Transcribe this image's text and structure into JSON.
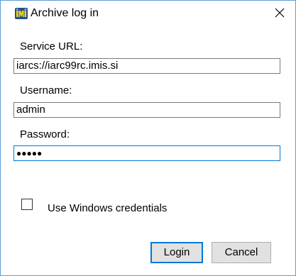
{
  "window": {
    "title": "Archive log in",
    "app_icon": "imis-logo-icon",
    "close_glyph": "close-icon"
  },
  "form": {
    "service_url_label": "Service URL:",
    "service_url_value": "iarcs://iarc99rc.imis.si",
    "username_label": "Username:",
    "username_value": "admin",
    "password_label": "Password:",
    "password_masked": "●●●●●",
    "use_windows_credentials_label": "Use Windows credentials",
    "use_windows_credentials_checked": false
  },
  "buttons": {
    "login_label": "Login",
    "cancel_label": "Cancel"
  },
  "colors": {
    "accent": "#0078d7",
    "window_border": "#5b9bd5",
    "button_face": "#e1e1e1"
  }
}
